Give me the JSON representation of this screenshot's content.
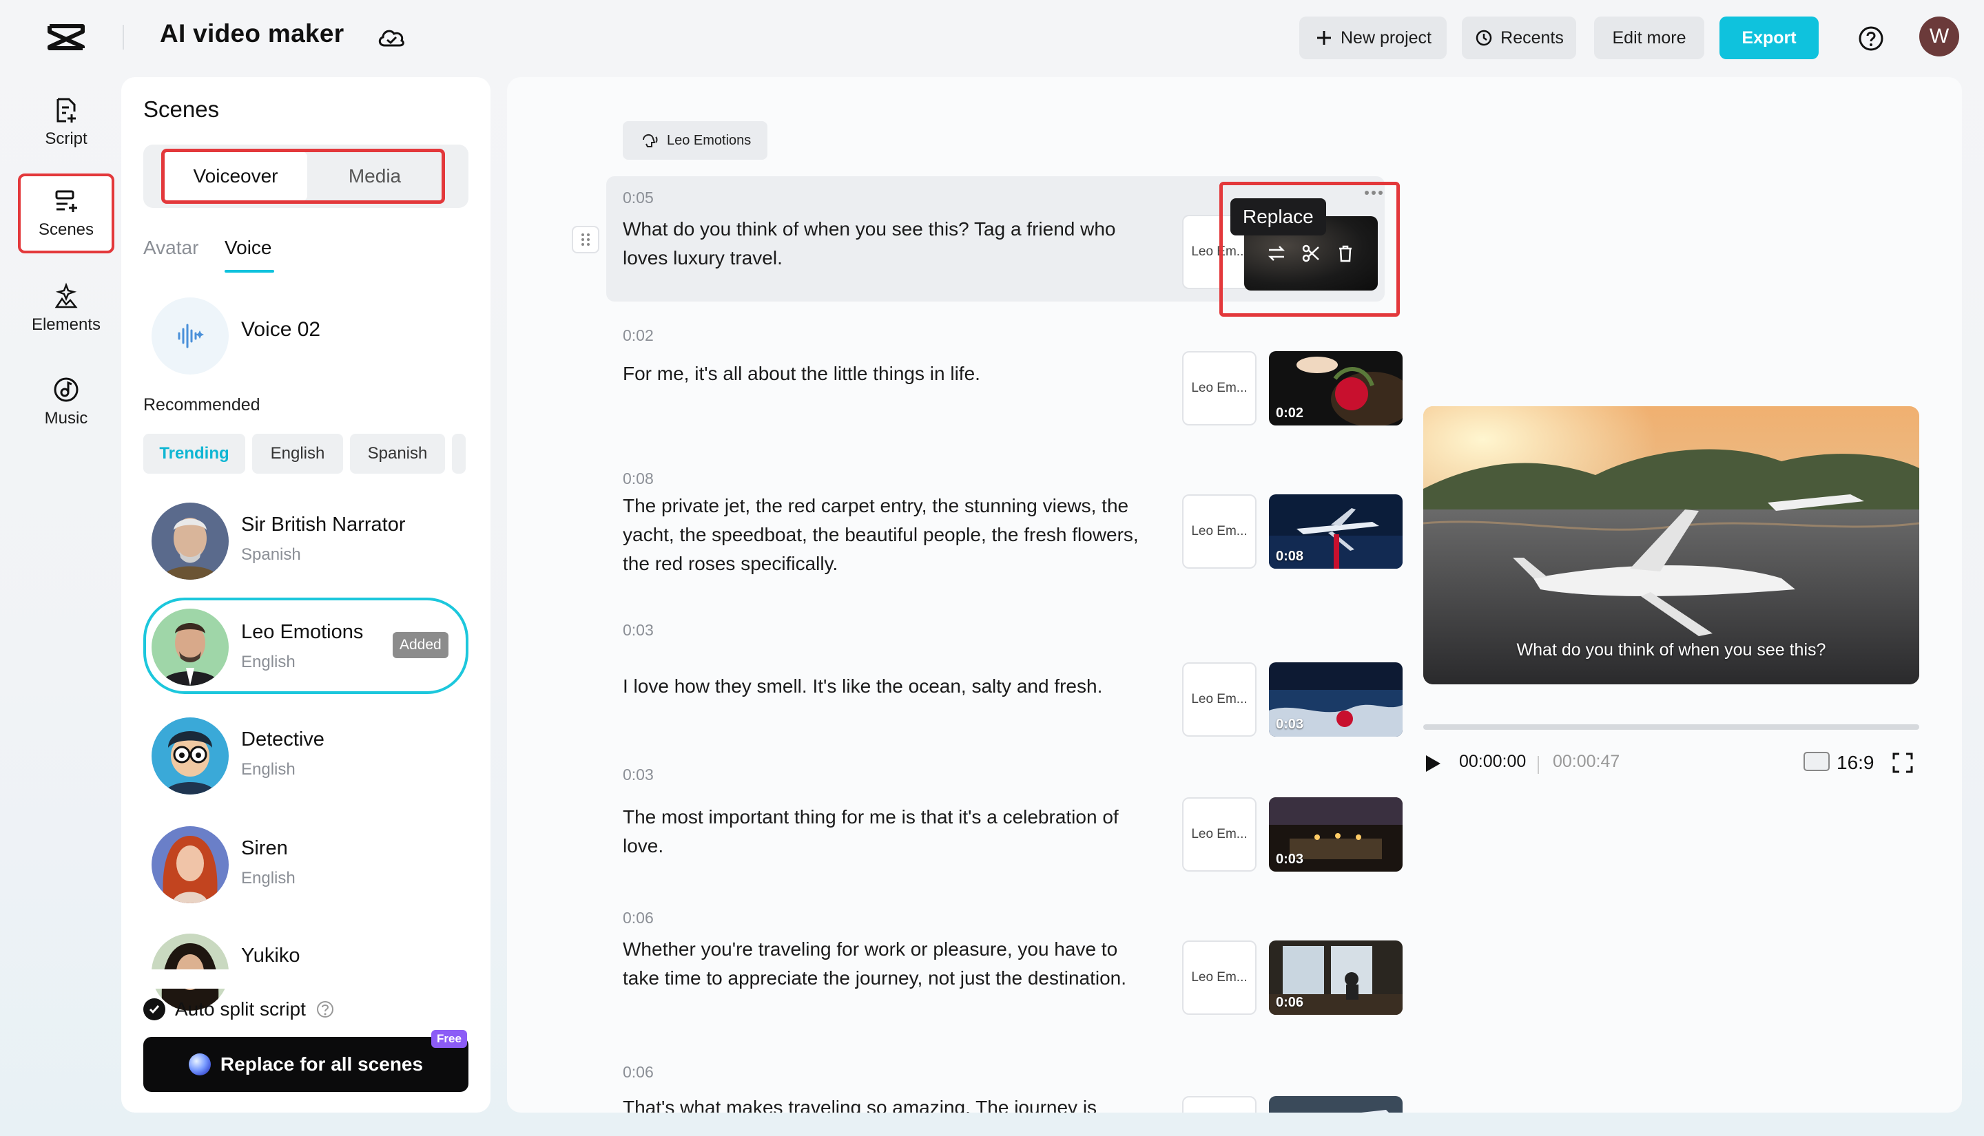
{
  "header": {
    "app_title": "AI video maker",
    "new_project_label": "New project",
    "recents_label": "Recents",
    "edit_more_label": "Edit more",
    "export_label": "Export",
    "user_initial": "W"
  },
  "rail": {
    "items": [
      {
        "label": "Script",
        "icon": "script-icon"
      },
      {
        "label": "Scenes",
        "icon": "scenes-icon",
        "active": true
      },
      {
        "label": "Elements",
        "icon": "elements-icon"
      },
      {
        "label": "Music",
        "icon": "music-icon"
      }
    ]
  },
  "scenes_panel": {
    "title": "Scenes",
    "segment": {
      "voiceover": "Voiceover",
      "media": "Media",
      "selected": "Voiceover"
    },
    "subtabs": {
      "avatar": "Avatar",
      "voice": "Voice",
      "selected": "Voice"
    },
    "current_voice": "Voice 02",
    "recommended_label": "Recommended",
    "filters": [
      "Trending",
      "English",
      "Spanish"
    ],
    "active_filter": "Trending",
    "voices": [
      {
        "name": "Sir British Narrator",
        "language": "Spanish"
      },
      {
        "name": "Leo Emotions",
        "language": "English",
        "badge": "Added",
        "selected": true
      },
      {
        "name": "Detective",
        "language": "English"
      },
      {
        "name": "Siren",
        "language": "English"
      },
      {
        "name": "Yukiko",
        "language": ""
      }
    ],
    "auto_split_label": "Auto split script",
    "auto_split_checked": true,
    "replace_all_label": "Replace for all scenes",
    "free_badge": "Free"
  },
  "main": {
    "speaker_tag": "Leo Emotions",
    "replace_tooltip": "Replace",
    "scenes": [
      {
        "time": "0:05",
        "text": "What do you think of when you see this? Tag a friend who loves luxury travel.",
        "voice_chip": "Leo Em...",
        "duration": "",
        "active": true
      },
      {
        "time": "0:02",
        "text": "For me, it's all about the little things in life.",
        "voice_chip": "Leo Em...",
        "duration": "0:02"
      },
      {
        "time": "0:08",
        "text": "The private jet, the red carpet entry, the stunning views, the yacht, the speedboat, the beautiful people, the fresh flowers, the red roses specifically.",
        "voice_chip": "Leo Em...",
        "duration": "0:08"
      },
      {
        "time": "0:03",
        "text": "I love how they smell. It's like the ocean, salty and fresh.",
        "voice_chip": "Leo Em...",
        "duration": "0:03"
      },
      {
        "time": "0:03",
        "text": "The most important thing for me is that it's a celebration of love.",
        "voice_chip": "Leo Em...",
        "duration": "0:03"
      },
      {
        "time": "0:06",
        "text": "Whether you're traveling for work or pleasure, you have to take time to appreciate the journey, not just the destination.",
        "voice_chip": "Leo Em...",
        "duration": "0:06"
      },
      {
        "time": "0:06",
        "text": "That's what makes traveling so amazing. The journey is",
        "voice_chip": "",
        "duration": ""
      }
    ],
    "preview": {
      "caption": "What do you think of when you see this?",
      "current_time": "00:00:00",
      "total_time": "00:00:47",
      "aspect_ratio": "16:9",
      "progress": 0
    }
  },
  "colors": {
    "accent": "#0fc2dd",
    "highlight": "#e3383b",
    "free_badge": "#8c5cf6"
  }
}
